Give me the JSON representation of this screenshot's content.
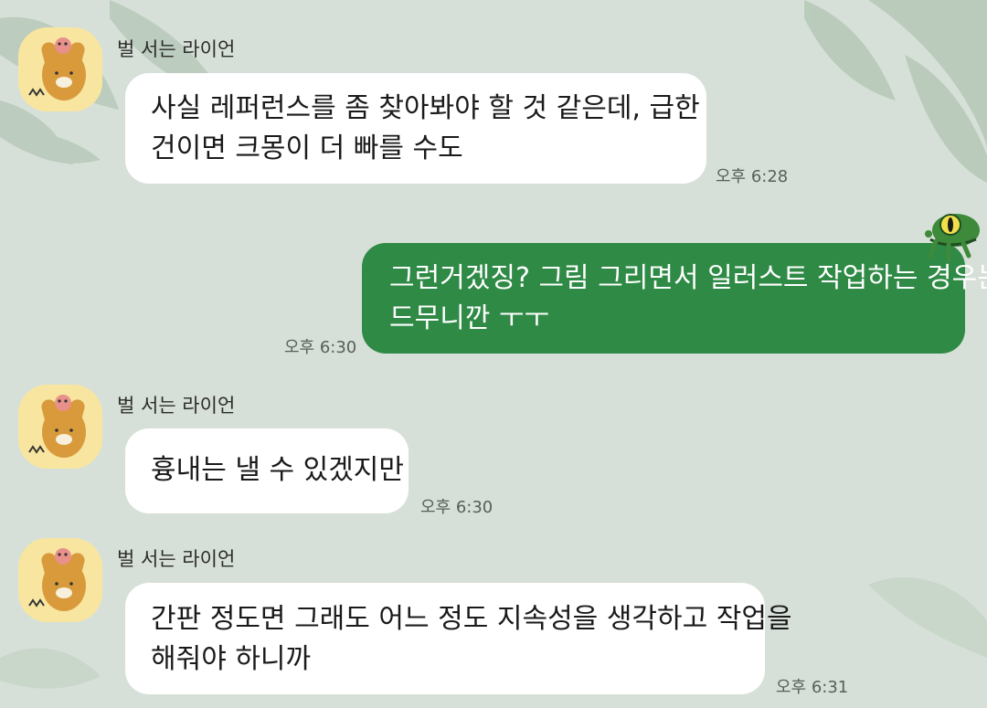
{
  "chat": {
    "messages": [
      {
        "direction": "incoming",
        "sender": "벌 서는 라이언",
        "avatar_icon": "ryan-character-avatar-icon",
        "lines": [
          "사실 레퍼런스를 좀 찾아봐야 할 것 같은데, 급한",
          "건이면 크몽이 더 빠를 수도"
        ],
        "time": "오후 6:28"
      },
      {
        "direction": "outgoing",
        "sticker_icon": "green-frog-sticker-icon",
        "lines": [
          "그런거겠징? 그림 그리면서 일러스트 작업하는 경우는",
          "드무니깐 ㅜㅜ"
        ],
        "time": "오후 6:30"
      },
      {
        "direction": "incoming",
        "sender": "벌 서는 라이언",
        "avatar_icon": "ryan-character-avatar-icon",
        "lines": [
          "흉내는 낼 수 있겠지만"
        ],
        "time": "오후 6:30"
      },
      {
        "direction": "incoming",
        "sender": "벌 서는 라이언",
        "avatar_icon": "ryan-character-avatar-icon",
        "lines": [
          "간판 정도면 그래도 어느 정도 지속성을 생각하고 작업을",
          "해줘야 하니까"
        ],
        "time": "오후 6:31"
      }
    ]
  },
  "theme": {
    "background": "#d7e0d8",
    "incoming_bubble": "#ffffff",
    "outgoing_bubble": "#2f8a46",
    "avatar_bg": "#f7e5a0"
  }
}
